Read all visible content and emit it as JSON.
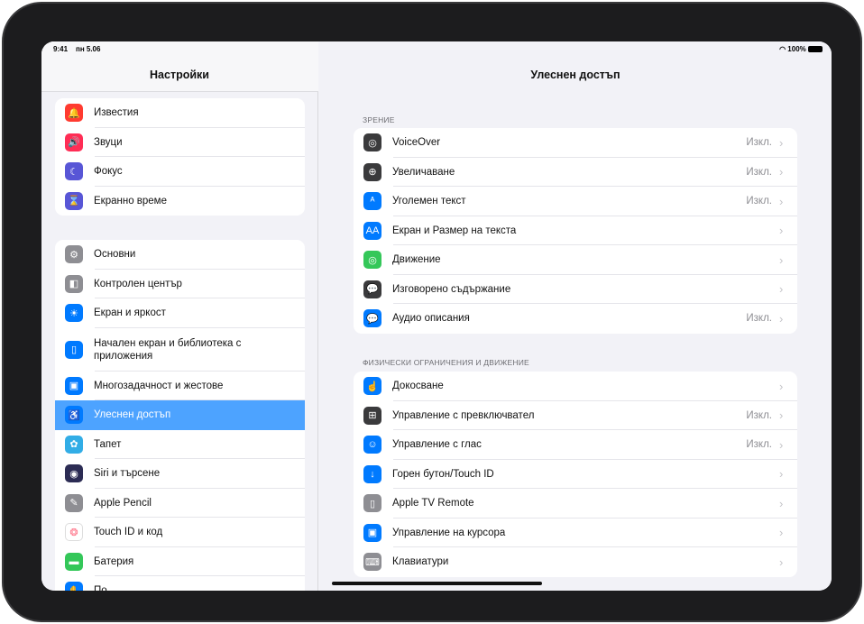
{
  "status": {
    "time": "9:41",
    "date": "пн 5.06",
    "battery": "100%"
  },
  "sidebar": {
    "title": "Настройки",
    "group1": [
      {
        "label": "Известия",
        "icon": "bell-icon",
        "color": "#ff3b30",
        "glyph": "🔔"
      },
      {
        "label": "Звуци",
        "icon": "speaker-icon",
        "color": "#ff2d55",
        "glyph": "🔊"
      },
      {
        "label": "Фокус",
        "icon": "moon-icon",
        "color": "#5856d6",
        "glyph": "☾"
      },
      {
        "label": "Екранно време",
        "icon": "hourglass-icon",
        "color": "#5856d6",
        "glyph": "⌛"
      }
    ],
    "group2": [
      {
        "label": "Основни",
        "icon": "gear-icon",
        "color": "#8e8e93",
        "glyph": "⚙"
      },
      {
        "label": "Контролен център",
        "icon": "switches-icon",
        "color": "#8e8e93",
        "glyph": "◧"
      },
      {
        "label": "Екран и яркост",
        "icon": "sun-icon",
        "color": "#007aff",
        "glyph": "☀"
      },
      {
        "label": "Начален екран и библиотека с приложения",
        "icon": "home-screen-icon",
        "color": "#007aff",
        "glyph": "▯"
      },
      {
        "label": "Многозадачност и жестове",
        "icon": "multitask-icon",
        "color": "#007aff",
        "glyph": "▣"
      },
      {
        "label": "Улеснен достъп",
        "icon": "accessibility-icon",
        "color": "#007aff",
        "glyph": "♿",
        "selected": true
      },
      {
        "label": "Тапет",
        "icon": "flower-icon",
        "color": "#32ade6",
        "glyph": "✿"
      },
      {
        "label": "Siri и търсене",
        "icon": "siri-icon",
        "color": "#2c2c54",
        "glyph": "◉"
      },
      {
        "label": "Apple Pencil",
        "icon": "pencil-icon",
        "color": "#8e8e93",
        "glyph": "✎"
      },
      {
        "label": "Touch ID и код",
        "icon": "fingerprint-icon",
        "color": "#ffffff",
        "glyph": "❂"
      },
      {
        "label": "Батерия",
        "icon": "battery-icon",
        "color": "#34c759",
        "glyph": "▬"
      },
      {
        "label": "По",
        "icon": "hand-icon",
        "color": "#007aff",
        "glyph": "✋"
      }
    ]
  },
  "main": {
    "title": "Улеснен достъп",
    "sections": [
      {
        "label": "ЗРЕНИЕ",
        "rows": [
          {
            "label": "VoiceOver",
            "value": "Изкл.",
            "icon": "voiceover-icon",
            "color": "#3a3a3c",
            "glyph": "◎"
          },
          {
            "label": "Увеличаване",
            "value": "Изкл.",
            "icon": "zoom-icon",
            "color": "#3a3a3c",
            "glyph": "⊕"
          },
          {
            "label": "Уголемен текст",
            "value": "Изкл.",
            "icon": "hover-text-icon",
            "color": "#007aff",
            "glyph": "ᴬ"
          },
          {
            "label": "Екран и Размер на текста",
            "value": "",
            "icon": "text-size-icon",
            "color": "#007aff",
            "glyph": "AA"
          },
          {
            "label": "Движение",
            "value": "",
            "icon": "motion-icon",
            "color": "#34c759",
            "glyph": "◎"
          },
          {
            "label": "Изговорено съдържание",
            "value": "",
            "icon": "spoken-content-icon",
            "color": "#3a3a3c",
            "glyph": "💬"
          },
          {
            "label": "Аудио описания",
            "value": "Изкл.",
            "icon": "audio-description-icon",
            "color": "#007aff",
            "glyph": "💬"
          }
        ]
      },
      {
        "label": "ФИЗИЧЕСКИ ОГРАНИЧЕНИЯ И ДВИЖЕНИЕ",
        "rows": [
          {
            "label": "Докосване",
            "value": "",
            "icon": "touch-icon",
            "color": "#007aff",
            "glyph": "☝"
          },
          {
            "label": "Управление с превключвател",
            "value": "Изкл.",
            "icon": "switch-control-icon",
            "color": "#3a3a3c",
            "glyph": "⊞"
          },
          {
            "label": "Управление с глас",
            "value": "Изкл.",
            "icon": "voice-control-icon",
            "color": "#007aff",
            "glyph": "☺"
          },
          {
            "label": "Горен бутон/Touch ID",
            "value": "",
            "icon": "top-button-icon",
            "color": "#007aff",
            "glyph": "↓"
          },
          {
            "label": "Apple TV Remote",
            "value": "",
            "icon": "remote-icon",
            "color": "#8e8e93",
            "glyph": "▯"
          },
          {
            "label": "Управление на курсора",
            "value": "",
            "icon": "pointer-icon",
            "color": "#007aff",
            "glyph": "▣"
          },
          {
            "label": "Клавиатури",
            "value": "",
            "icon": "keyboard-icon",
            "color": "#8e8e93",
            "glyph": "⌨"
          }
        ]
      }
    ]
  }
}
